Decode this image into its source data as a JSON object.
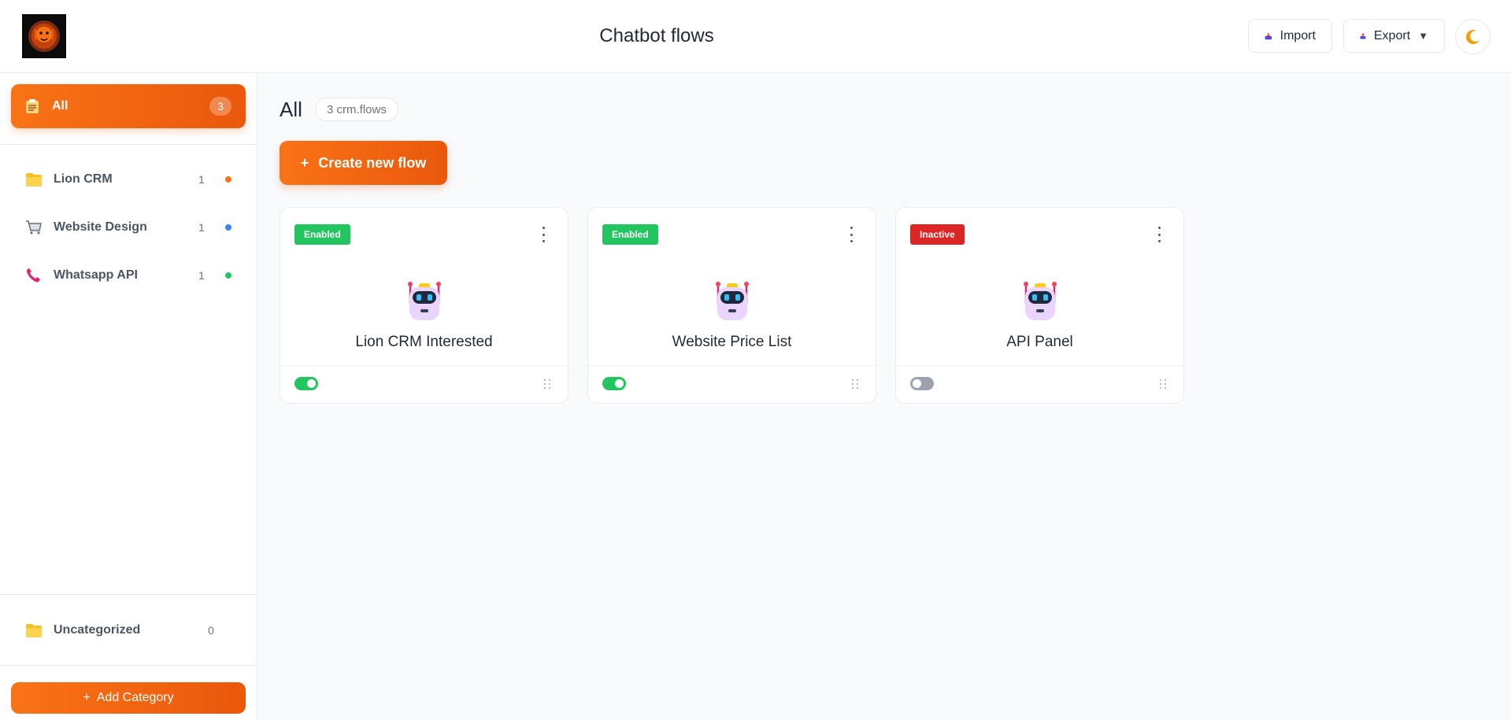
{
  "header": {
    "title": "Chatbot flows",
    "import_label": "Import",
    "export_label": "Export"
  },
  "sidebar": {
    "all": {
      "label": "All",
      "count": "3"
    },
    "categories": [
      {
        "label": "Lion CRM",
        "count": "1",
        "icon": "folder-icon",
        "dot_color": "#f97316"
      },
      {
        "label": "Website Design",
        "count": "1",
        "icon": "cart-icon",
        "dot_color": "#3b82f6"
      },
      {
        "label": "Whatsapp API",
        "count": "1",
        "icon": "phone-icon",
        "dot_color": "#22c55e"
      }
    ],
    "uncategorized": {
      "label": "Uncategorized",
      "count": "0"
    },
    "add_category_label": "Add Category"
  },
  "main": {
    "title": "All",
    "count_label": "3 crm.flows",
    "create_label": "Create new flow",
    "flows": [
      {
        "name": "Lion CRM Interested",
        "status": "Enabled",
        "active": true
      },
      {
        "name": "Website Price List",
        "status": "Enabled",
        "active": true
      },
      {
        "name": "API Panel",
        "status": "Inactive",
        "active": false
      }
    ]
  },
  "colors": {
    "accent": "#f97316",
    "enabled": "#22c55e",
    "inactive": "#dc2626"
  }
}
